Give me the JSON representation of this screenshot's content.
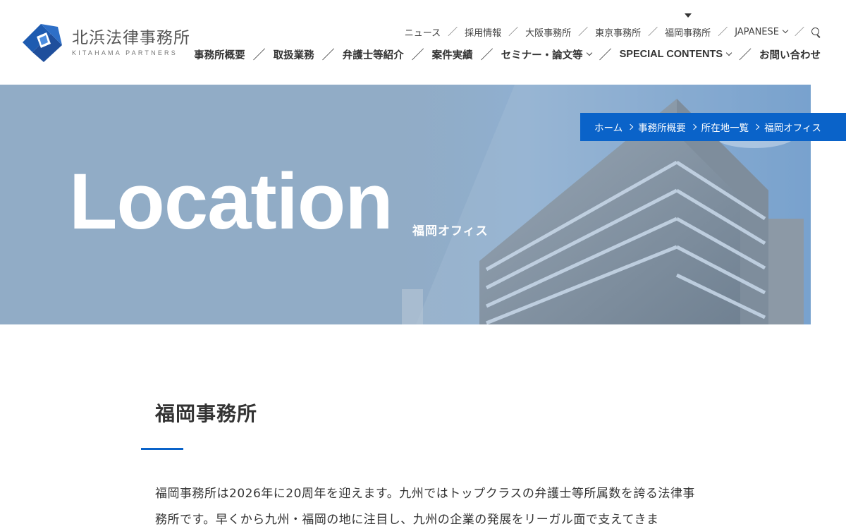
{
  "logo": {
    "name_jp": "北浜法律事務所",
    "name_en": "KITAHAMA PARTNERS"
  },
  "util_nav": {
    "items": [
      "ニュース",
      "採用情報",
      "大阪事務所",
      "東京事務所",
      "福岡事務所",
      "JAPANESE"
    ],
    "active": "福岡事務所"
  },
  "main_nav": {
    "items": [
      "事務所概要",
      "取扱業務",
      "弁護士等紹介",
      "案件実績",
      "セミナー・論文等",
      "SPECIAL CONTENTS",
      "お問い合わせ"
    ]
  },
  "hero": {
    "title": "Location",
    "subtitle": "福岡オフィス"
  },
  "breadcrumb": {
    "items": [
      "ホーム",
      "事務所概要",
      "所在地一覧",
      "福岡オフィス"
    ]
  },
  "content": {
    "heading": "福岡事務所",
    "paragraph": "福岡事務所は2026年に20周年を迎えます。九州ではトップクラスの弁護士等所属数を誇る法律事務所です。早くから九州・福岡の地に注目し、九州の企業の発展をリーガル面で支えてきま"
  },
  "colors": {
    "accent": "#0a63c9",
    "hero_bg": "#91acc6",
    "text": "#333333"
  }
}
